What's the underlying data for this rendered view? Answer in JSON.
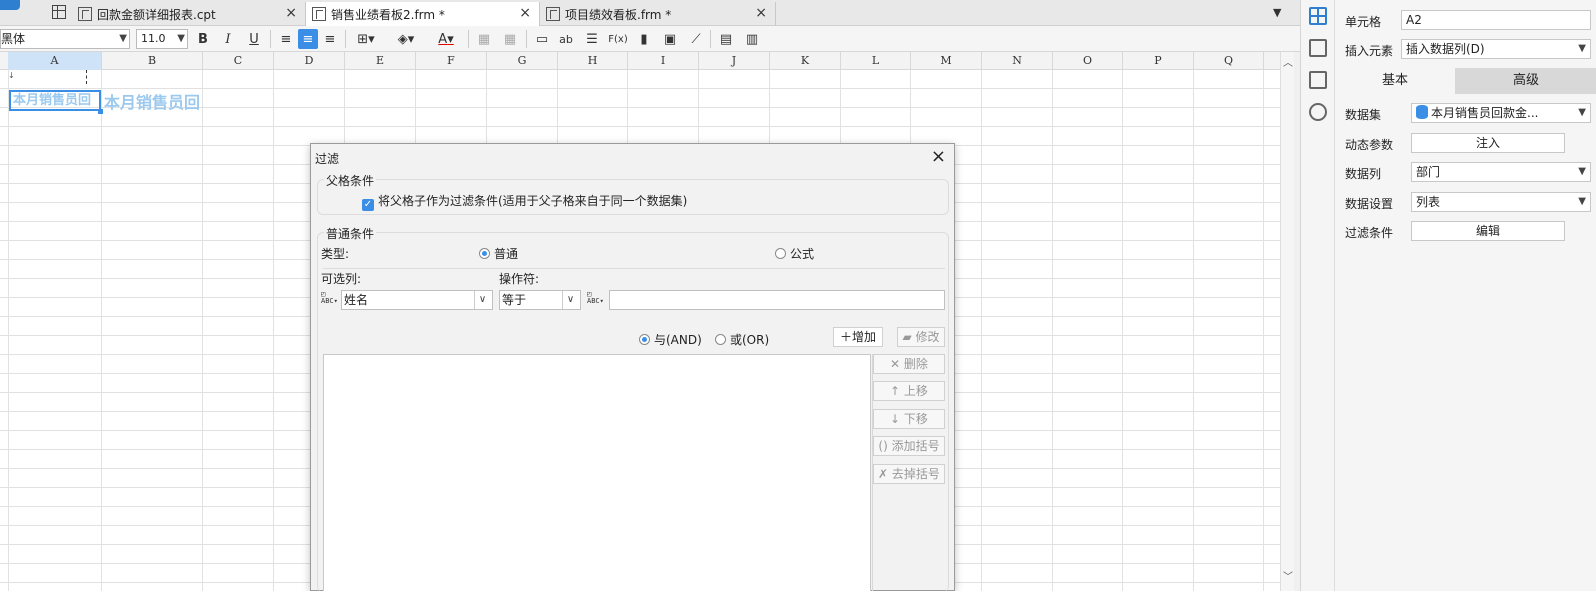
{
  "tabs": [
    {
      "label": "回款金额详细报表.cpt",
      "close": "×"
    },
    {
      "label": "销售业绩看板2.frm *",
      "close": "×"
    },
    {
      "label": "项目绩效看板.frm *",
      "close": "×"
    }
  ],
  "toolbar": {
    "font_name": "黑体",
    "font_size": "11.0",
    "bold": "B",
    "italic": "I",
    "underline": "U",
    "font_color": "A",
    "text_btn": "ab",
    "formula_btn": "F(x)"
  },
  "sheet": {
    "columns": [
      "A",
      "B",
      "C",
      "D",
      "E",
      "F",
      "G",
      "H",
      "I",
      "J",
      "K",
      "L",
      "M",
      "N",
      "O",
      "P",
      "Q"
    ],
    "cell_a2_text": "本月销售员回",
    "cell_b2_text": "本月销售员回"
  },
  "panel": {
    "cell_label": "单元格",
    "cell_value": "A2",
    "insert_label": "插入元素",
    "insert_value": "插入数据列(D)",
    "tab_basic": "基本",
    "tab_advanced": "高级",
    "dataset_label": "数据集",
    "dataset_value": "本月销售员回款金...",
    "dynparam_label": "动态参数",
    "dynparam_btn": "注入",
    "datacol_label": "数据列",
    "datacol_value": "部门",
    "dataset_setting_label": "数据设置",
    "dataset_setting_value": "列表",
    "filter_label": "过滤条件",
    "filter_btn": "编辑"
  },
  "dialog": {
    "title": "过滤",
    "close": "×",
    "parent_group": "父格条件",
    "parent_checkbox": "将父格子作为过滤条件(适用于父子格来自于同一个数据集)",
    "normal_group": "普通条件",
    "type_label": "类型:",
    "type_normal": "普通",
    "type_formula": "公式",
    "col_label": "可选列:",
    "op_label": "操作符:",
    "col_value": "姓名",
    "op_value": "等于",
    "value_input": "",
    "and_label": "与(AND)",
    "or_label": "或(OR)",
    "add_btn": "增加",
    "edit_btn": "修改",
    "delete_btn": "删除",
    "up_btn": "上移",
    "down_btn": "下移",
    "add_bracket_btn": "添加括号",
    "remove_bracket_btn": "去掉括号"
  }
}
